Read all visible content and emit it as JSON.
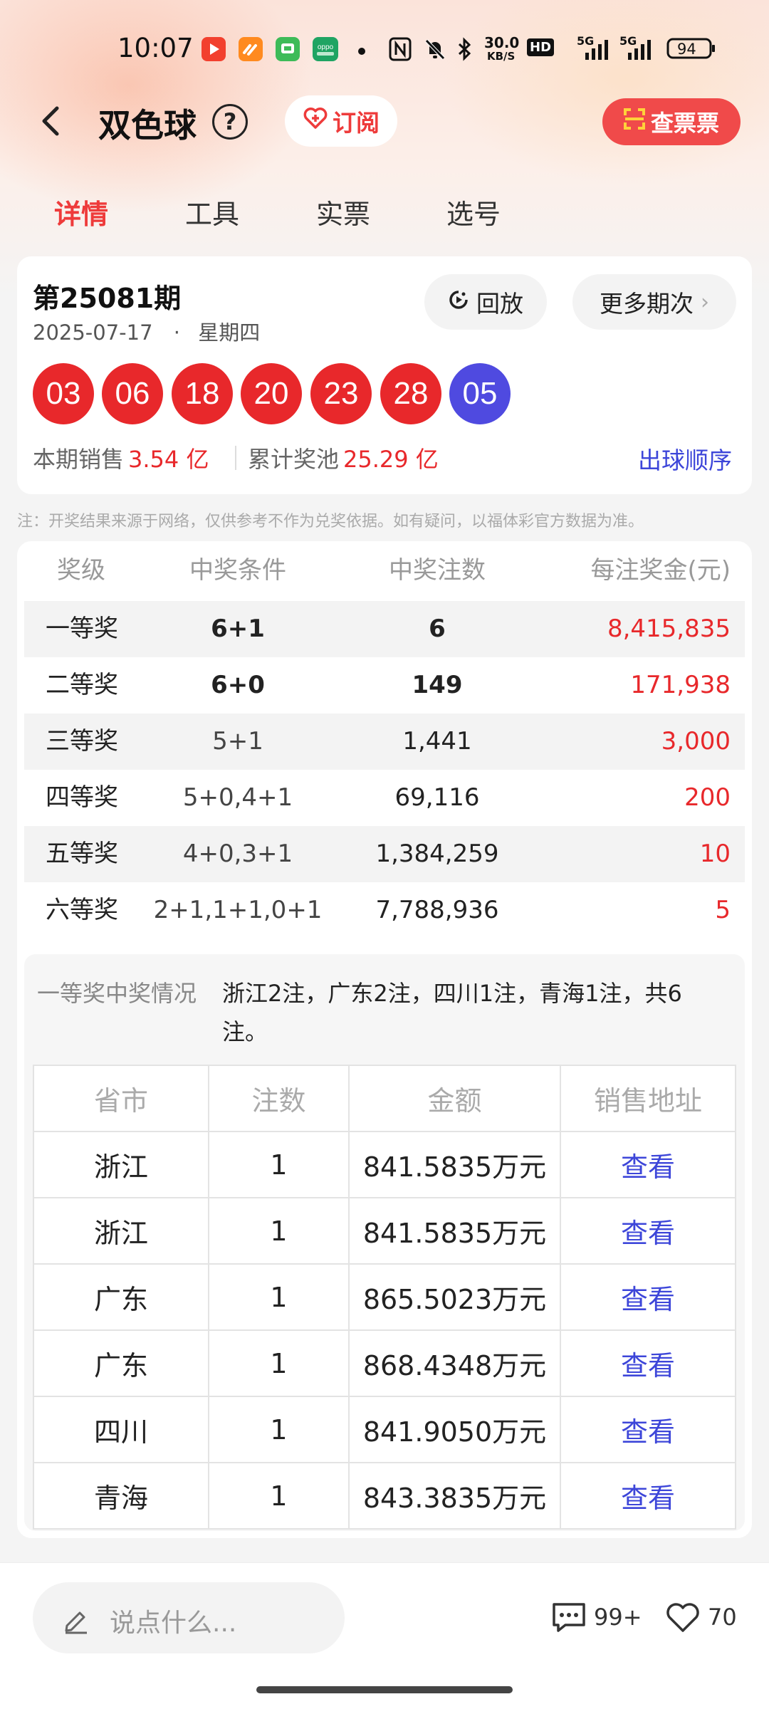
{
  "status_bar": {
    "time": "10:07",
    "network_speed_top": "30.0",
    "network_speed_bottom": "KB/S",
    "hd_label": "HD",
    "sig1": "5G",
    "sig2": "5G",
    "battery": "94"
  },
  "header": {
    "title": "双色球",
    "help_glyph": "?",
    "subscribe_label": "订阅",
    "check_ticket_label": "查票票"
  },
  "tabs": [
    {
      "label": "详情",
      "active": true
    },
    {
      "label": "工具",
      "active": false
    },
    {
      "label": "实票",
      "active": false
    },
    {
      "label": "选号",
      "active": false
    }
  ],
  "draw": {
    "issue": "第25081期",
    "date": "2025-07-17",
    "separator": "·",
    "weekday": "星期四",
    "replay_label": "回放",
    "more_label": "更多期次",
    "more_chevron": "›",
    "red_balls": [
      "03",
      "06",
      "18",
      "20",
      "23",
      "28"
    ],
    "blue_ball": "05",
    "sales_label": "本期销售",
    "sales_value": "3.54 亿",
    "pool_label": "累计奖池",
    "pool_value": "25.29 亿",
    "order_link": "出球顺序"
  },
  "note": "注：开奖结果来源于网络，仅供参考不作为兑奖依据。如有疑问，以福体彩官方数据为准。",
  "prize_table": {
    "headers": [
      "奖级",
      "中奖条件",
      "中奖注数",
      "每注奖金(元)"
    ],
    "rows": [
      {
        "level": "一等奖",
        "condition": "6+1",
        "count": "6",
        "amount": "8,415,835"
      },
      {
        "level": "二等奖",
        "condition": "6+0",
        "count": "149",
        "amount": "171,938"
      },
      {
        "level": "三等奖",
        "condition": "5+1",
        "count": "1,441",
        "amount": "3,000"
      },
      {
        "level": "四等奖",
        "condition": "5+0,4+1",
        "count": "69,116",
        "amount": "200"
      },
      {
        "level": "五等奖",
        "condition": "4+0,3+1",
        "count": "1,384,259",
        "amount": "10"
      },
      {
        "level": "六等奖",
        "condition": "2+1,1+1,0+1",
        "count": "7,788,936",
        "amount": "5"
      }
    ]
  },
  "winners": {
    "label": "一等奖中奖情况",
    "summary": "浙江2注，广东2注，四川1注，青海1注，共6注。",
    "headers": [
      "省市",
      "注数",
      "金额",
      "销售地址"
    ],
    "rows": [
      {
        "province": "浙江",
        "count": "1",
        "amount": "841.5835万元",
        "link": "查看"
      },
      {
        "province": "浙江",
        "count": "1",
        "amount": "841.5835万元",
        "link": "查看"
      },
      {
        "province": "广东",
        "count": "1",
        "amount": "865.5023万元",
        "link": "查看"
      },
      {
        "province": "广东",
        "count": "1",
        "amount": "868.4348万元",
        "link": "查看"
      },
      {
        "province": "四川",
        "count": "1",
        "amount": "841.9050万元",
        "link": "查看"
      },
      {
        "province": "青海",
        "count": "1",
        "amount": "843.3835万元",
        "link": "查看"
      }
    ]
  },
  "bottom_bar": {
    "comment_placeholder": "说点什么...",
    "comment_count": "99+",
    "like_count": "70"
  },
  "colors": {
    "accent_red": "#e8282b",
    "blue_ball": "#4f4ae0",
    "link_blue": "#3d46d9"
  }
}
